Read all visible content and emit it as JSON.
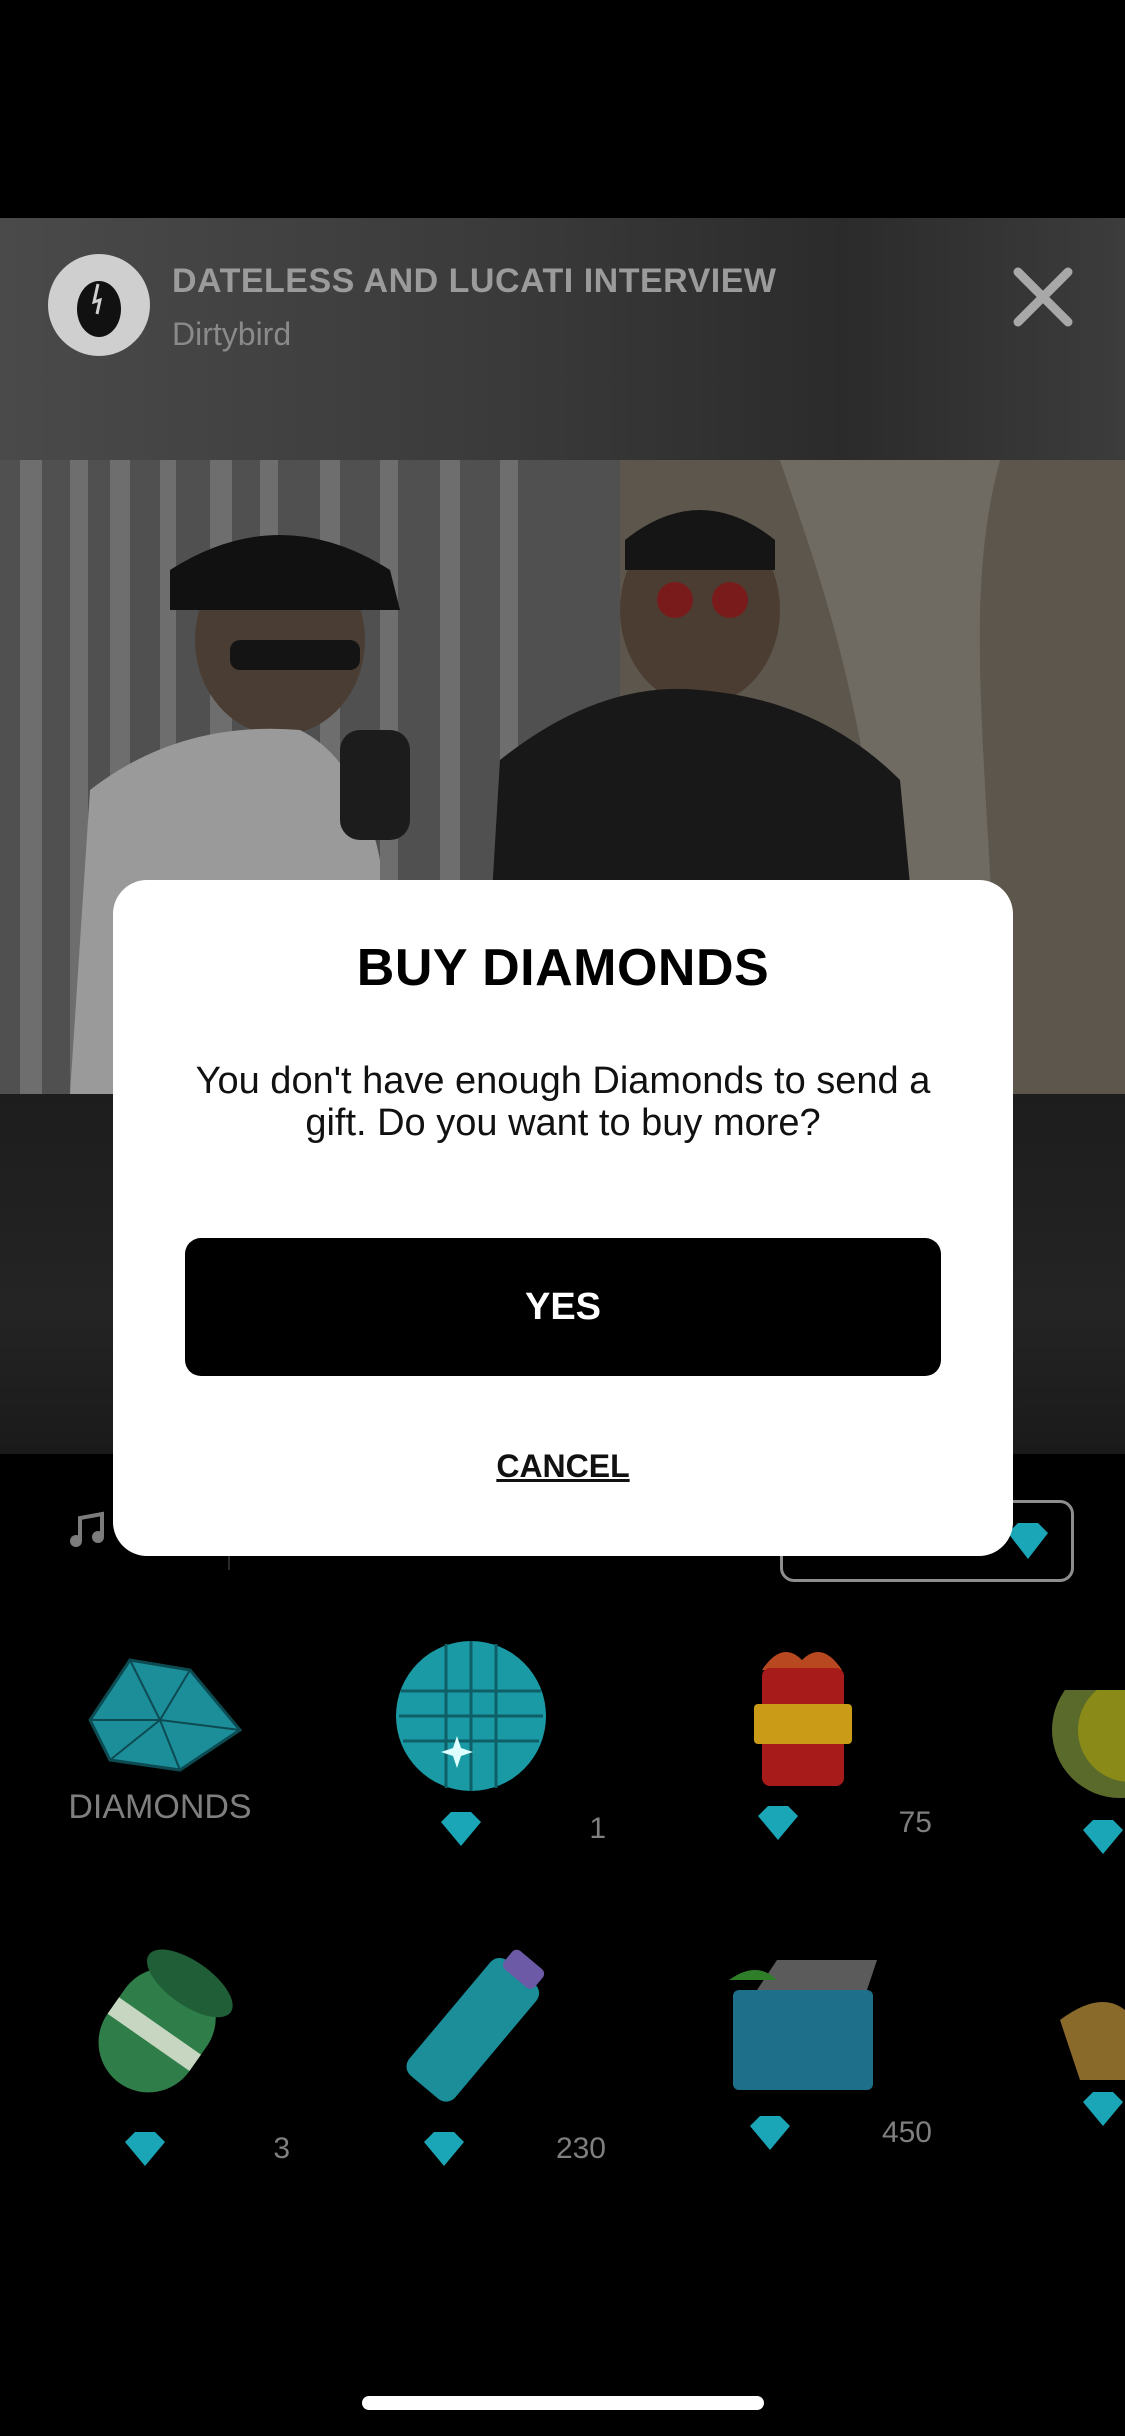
{
  "header": {
    "title": "DATELESS AND LUCATI INTERVIEW",
    "subtitle": "Dirtybird"
  },
  "icons": {
    "close": "close-icon",
    "music": "music-note-icon",
    "diamond": "diamond-icon"
  },
  "gifts": [
    {
      "label": "DIAMONDS",
      "price": null
    },
    {
      "label": "",
      "price": "1"
    },
    {
      "label": "",
      "price": "75"
    },
    {
      "label": "",
      "price": "3"
    },
    {
      "label": "",
      "price": "230"
    },
    {
      "label": "",
      "price": "450"
    }
  ],
  "modal": {
    "title": "BUY DIAMONDS",
    "message": "You don't have enough Diamonds to send a gift. Do you want to buy more?",
    "yes_label": "YES",
    "cancel_label": "CANCEL"
  },
  "colors": {
    "accent_diamond": "#1aa6b7",
    "modal_bg": "#ffffff",
    "primary_button": "#000000"
  }
}
